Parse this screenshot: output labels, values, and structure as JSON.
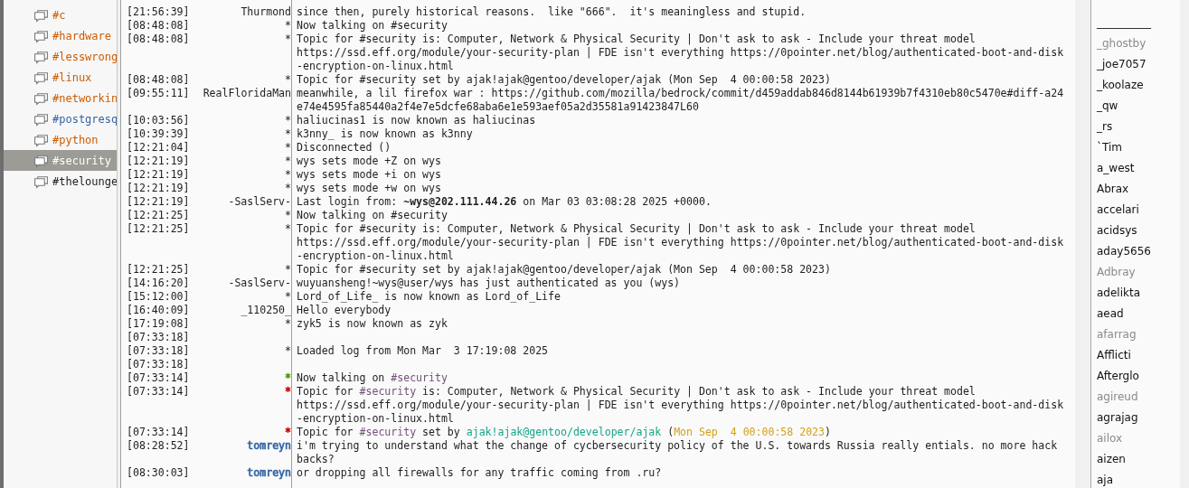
{
  "channels": [
    {
      "label": "#c",
      "color": "#ce5c00",
      "selected": false
    },
    {
      "label": "#hardware",
      "color": "#ce5c00",
      "selected": false
    },
    {
      "label": "#lesswrong",
      "color": "#ce5c00",
      "selected": false
    },
    {
      "label": "#linux",
      "color": "#ce5c00",
      "selected": false
    },
    {
      "label": "#networkin",
      "color": "#ce5c00",
      "selected": false
    },
    {
      "label": "#postgresq",
      "color": "#3465a4",
      "selected": false
    },
    {
      "label": "#python",
      "color": "#ce5c00",
      "selected": false
    },
    {
      "label": "#security",
      "selected": true
    },
    {
      "label": "#thelounge",
      "color": "#222222",
      "selected": false
    }
  ],
  "messages": [
    {
      "time": "[21:56:39]",
      "nick": "Thurmond",
      "lines": [
        [
          "since then, purely historical reasons.  like \"666\".  it's meaningless and stupid."
        ]
      ]
    },
    {
      "time": "[08:48:08]",
      "nick": "*",
      "lines": [
        [
          "Now talking on #security"
        ]
      ]
    },
    {
      "time": "[08:48:08]",
      "nick": "*",
      "lines": [
        [
          "Topic for #security is: Computer, Network & Physical Security | Don't ask to ask - Include your threat model"
        ],
        [
          "https://ssd.eff.org/module/your-security-plan | FDE isn't everything https://0pointer.net/blog/authenticated-boot-and-disk"
        ],
        [
          "-encryption-on-linux.html"
        ]
      ]
    },
    {
      "time": "[08:48:08]",
      "nick": "*",
      "lines": [
        [
          "Topic for #security set by ajak!ajak@gentoo/developer/ajak (Mon Sep  4 00:00:58 2023)"
        ]
      ]
    },
    {
      "time": "[09:55:11]",
      "nick": "RealFloridaMan",
      "lines": [
        [
          "meanwhile, a lil firefox war : https://github.com/mozilla/bedrock/commit/d459addab846d8144b61939b7f4310eb80c5470e#diff-a24"
        ],
        [
          "e74e4595fa85440a2f4e7e5dcfe68aba6e1e593aef05a2d35581a91423847L60"
        ]
      ]
    },
    {
      "time": "[10:03:56]",
      "nick": "*",
      "lines": [
        [
          "haliucinas1 is now known as haliucinas"
        ]
      ]
    },
    {
      "time": "[10:39:39]",
      "nick": "*",
      "lines": [
        [
          "k3nny_ is now known as k3nny"
        ]
      ]
    },
    {
      "time": "[12:21:04]",
      "nick": "*",
      "lines": [
        [
          "Disconnected ()"
        ]
      ]
    },
    {
      "time": "[12:21:19]",
      "nick": "*",
      "lines": [
        [
          "wys sets mode +Z on wys"
        ]
      ]
    },
    {
      "time": "[12:21:19]",
      "nick": "*",
      "lines": [
        [
          "wys sets mode +i on wys"
        ]
      ]
    },
    {
      "time": "[12:21:19]",
      "nick": "*",
      "lines": [
        [
          "wys sets mode +w on wys"
        ]
      ]
    },
    {
      "time": "[12:21:19]",
      "nick": "-SaslServ-",
      "lines": [
        [
          "Last login from: **~wys@202.111.44.26** on Mar 03 03:08:28 2025 +0000."
        ]
      ]
    },
    {
      "time": "[12:21:25]",
      "nick": "*",
      "lines": [
        [
          "Now talking on #security"
        ]
      ]
    },
    {
      "time": "[12:21:25]",
      "nick": "*",
      "lines": [
        [
          "Topic for #security is: Computer, Network & Physical Security | Don't ask to ask - Include your threat model"
        ],
        [
          "https://ssd.eff.org/module/your-security-plan | FDE isn't everything https://0pointer.net/blog/authenticated-boot-and-disk"
        ],
        [
          "-encryption-on-linux.html"
        ]
      ]
    },
    {
      "time": "[12:21:25]",
      "nick": "*",
      "lines": [
        [
          "Topic for #security set by ajak!ajak@gentoo/developer/ajak (Mon Sep  4 00:00:58 2023)"
        ]
      ]
    },
    {
      "time": "[14:16:20]",
      "nick": "-SaslServ-",
      "lines": [
        [
          "wuyuansheng!~wys@user/wys has just authenticated as you (wys)"
        ]
      ]
    },
    {
      "time": "[15:12:00]",
      "nick": "*",
      "lines": [
        [
          "Lord_of_Life_ is now known as Lord_of_Life"
        ]
      ]
    },
    {
      "time": "[16:40:09]",
      "nick": "_110250_",
      "lines": [
        [
          "Hello everybody"
        ]
      ]
    },
    {
      "time": "[17:19:08]",
      "nick": "*",
      "lines": [
        [
          "zyk5 is now known as zyk"
        ]
      ]
    },
    {
      "time": "[07:33:18]"
    },
    {
      "time": "[07:33:18]",
      "nick": "*",
      "lines": [
        [
          "Loaded log from Mon Mar  3 17:19:08 2025"
        ]
      ]
    },
    {
      "time": "[07:33:18]"
    },
    {
      "time": "[07:33:14]",
      "nick": "*",
      "color": "#4e9a06",
      "lines": [
        [
          "Now talking on ",
          {
            "text": "#security",
            "color": "#75507b"
          }
        ]
      ]
    },
    {
      "time": "[07:33:14]",
      "nick": "*",
      "color": "#cc0000",
      "lines": [
        [
          "Topic for ",
          {
            "text": "#security",
            "color": "#75507b"
          },
          " is: Computer, Network & Physical Security | Don't ask to ask - Include your threat model"
        ],
        [
          "https://ssd.eff.org/module/your-security-plan | FDE isn't everything https://0pointer.net/blog/authenticated-boot-and-disk"
        ],
        [
          "-encryption-on-linux.html"
        ]
      ]
    },
    {
      "time": "[07:33:14]",
      "nick": "*",
      "color": "#cc0000",
      "lines": [
        [
          "Topic for ",
          {
            "text": "#security",
            "color": "#75507b"
          },
          " set by ",
          {
            "text": "ajak!ajak@gentoo/developer/ajak",
            "color": "#17a589"
          },
          " (",
          {
            "text": "Mon Sep  4 00:00:58 2023",
            "color": "#d4a017"
          },
          ")"
        ]
      ]
    },
    {
      "time": "[08:28:52]",
      "nick": "tomreyn",
      "color": "#3465a4",
      "lines": [
        [
          "i'm trying to understand what the change of cycbersecurity policy of the U.S. towards Russia really entials. no more hack"
        ],
        [
          "backs?"
        ]
      ]
    },
    {
      "time": "[08:30:03]",
      "nick": "tomreyn",
      "color": "#3465a4",
      "lines": [
        [
          "or dropping all firewalls for any traffic coming from .ru?"
        ]
      ]
    }
  ],
  "users": [
    {
      "name": "__________",
      "away": false
    },
    {
      "name": "_ghostby",
      "away": true
    },
    {
      "name": "_joe7057",
      "away": false
    },
    {
      "name": "_koolaze",
      "away": false
    },
    {
      "name": "_qw",
      "away": false
    },
    {
      "name": "_rs",
      "away": false
    },
    {
      "name": "`Tim",
      "away": false
    },
    {
      "name": "a_west",
      "away": false
    },
    {
      "name": "Abrax",
      "away": false
    },
    {
      "name": "accelari",
      "away": false
    },
    {
      "name": "acidsys",
      "away": false
    },
    {
      "name": "aday5656",
      "away": false
    },
    {
      "name": "Adbray",
      "away": true
    },
    {
      "name": "adelikta",
      "away": false
    },
    {
      "name": "aead",
      "away": false
    },
    {
      "name": "afarrag",
      "away": true
    },
    {
      "name": "Afflicti",
      "away": false
    },
    {
      "name": "Afterglo",
      "away": false
    },
    {
      "name": "agireud",
      "away": true
    },
    {
      "name": "agrajag",
      "away": false
    },
    {
      "name": "ailox",
      "away": true
    },
    {
      "name": "aizen",
      "away": false
    },
    {
      "name": "aja",
      "away": false
    }
  ]
}
